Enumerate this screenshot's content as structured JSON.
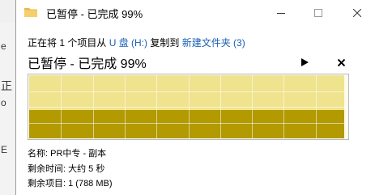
{
  "background": {
    "fragments": [
      "e",
      "正",
      "o",
      "E"
    ]
  },
  "window": {
    "title": "已暂停 - 已完成 99%",
    "controls": {
      "minimize_icon": "minimize-icon",
      "maximize_icon": "maximize-icon",
      "close_icon": "close-icon"
    }
  },
  "copy": {
    "prefix": "正在将 1 个项目从",
    "source": "U 盘 (H:)",
    "middle": "复制到",
    "destination": "新建文件夹 (3)"
  },
  "status": {
    "heading": "已暂停 - 已完成 99%",
    "resume_icon": "play-icon",
    "cancel_icon": "close-icon"
  },
  "progress": {
    "percent": 99,
    "speed_level": 0.45,
    "colors": {
      "fill": "#f0e38e",
      "speed": "#b29a00",
      "empty": "#fffbe6"
    }
  },
  "details": {
    "name": "名称: PR中专 - 副本",
    "remaining_time": "剩余时间: 大约 5 秒",
    "remaining_items": "剩余项目: 1 (788 MB)"
  }
}
